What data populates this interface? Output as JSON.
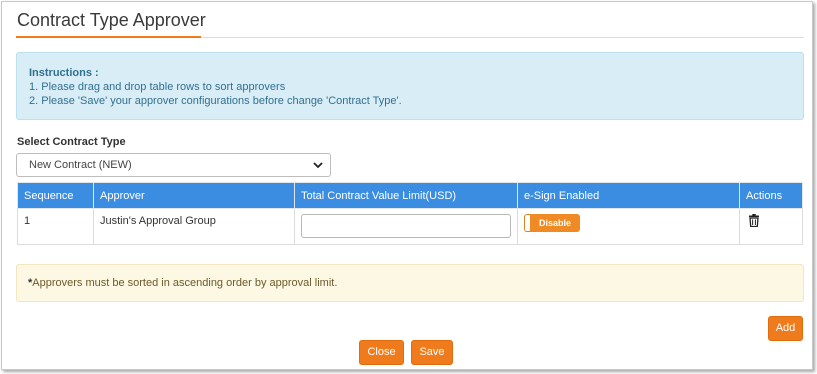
{
  "dialog": {
    "title": "Contract Type Approver"
  },
  "instructions": {
    "title": "Instructions :",
    "lines": [
      "1. Please drag and drop table rows to sort approvers",
      "2. Please 'Save' your approver configurations before change 'Contract Type'."
    ]
  },
  "contract_type": {
    "label": "Select Contract Type",
    "selected": "New Contract (NEW)"
  },
  "table": {
    "headers": [
      "Sequence",
      "Approver",
      "Total Contract Value Limit(USD)",
      "e-Sign Enabled",
      "Actions"
    ],
    "rows": [
      {
        "sequence": "1",
        "approver": "Justin's Approval Group",
        "limit_value": "",
        "esign_label": "Disable",
        "delete_icon": "trash-icon"
      }
    ]
  },
  "note": {
    "star": "*",
    "text": "Approvers must be sorted in ascending order by approval limit."
  },
  "buttons": {
    "add": "Add",
    "close": "Close",
    "save": "Save"
  },
  "colors": {
    "accent": "#f07b1d",
    "table_header": "#3b8de2",
    "info_bg": "#d9edf7",
    "warning_bg": "#fcf8e3"
  }
}
